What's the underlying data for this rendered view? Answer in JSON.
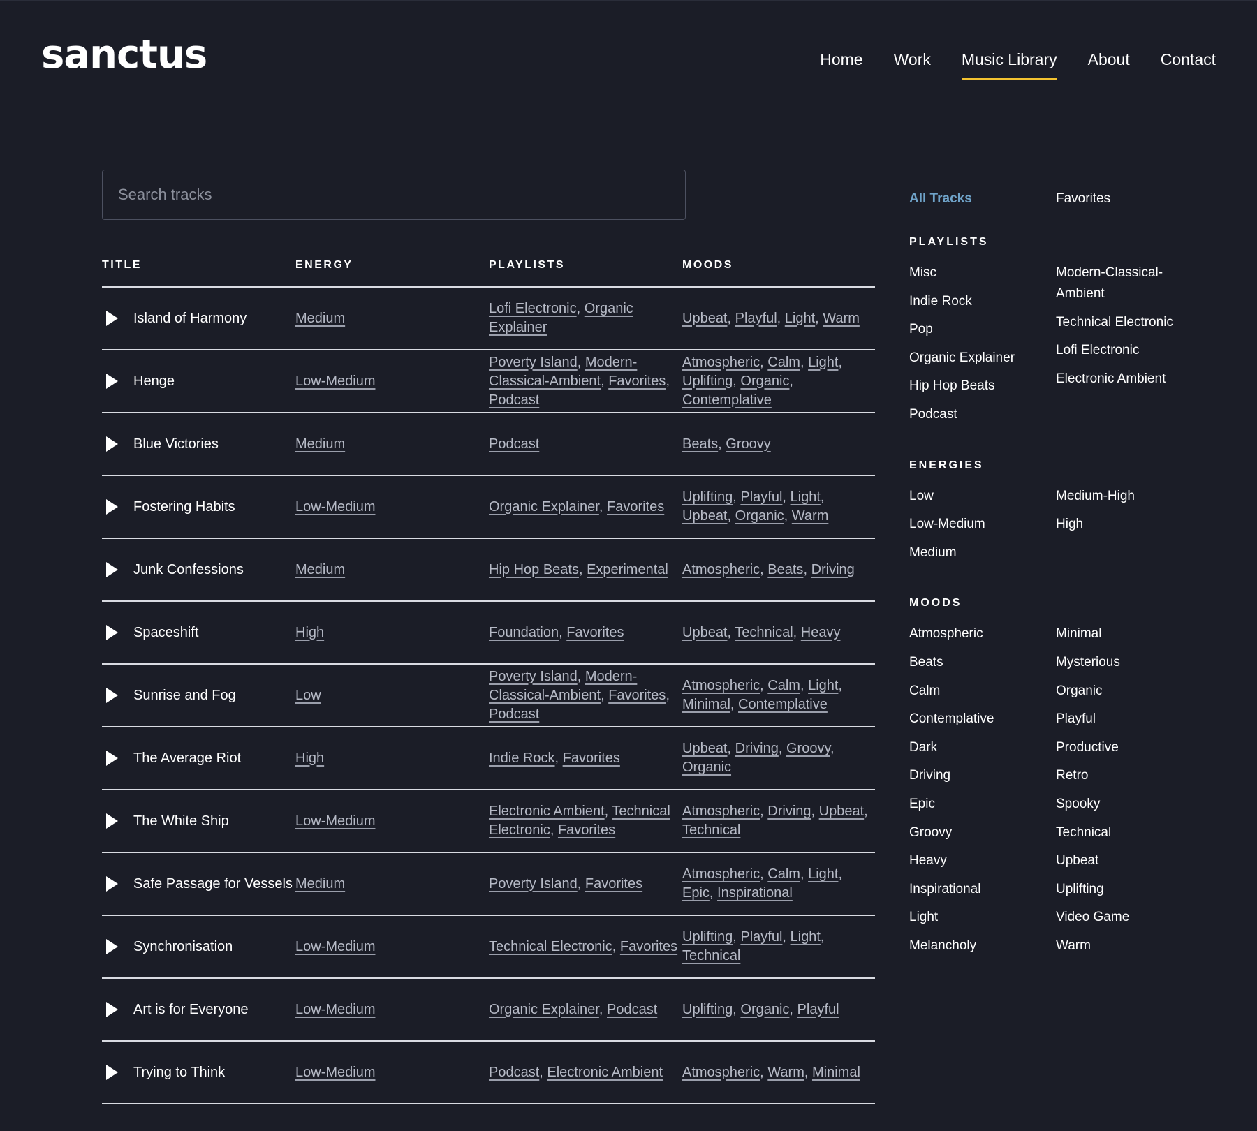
{
  "header": {
    "logo": "sanctus",
    "nav": [
      "Home",
      "Work",
      "Music Library",
      "About",
      "Contact"
    ],
    "active_nav": "Music Library",
    "accent_color": "#f2c230"
  },
  "search": {
    "placeholder": "Search tracks"
  },
  "table": {
    "columns": [
      "TITLE",
      "ENERGY",
      "PLAYLISTS",
      "MOODS"
    ],
    "rows": [
      {
        "title": "Island of Harmony",
        "energy": "Medium",
        "playlists": [
          "Lofi Electronic",
          "Organic Explainer"
        ],
        "moods": [
          "Upbeat",
          "Playful",
          "Light",
          "Warm"
        ]
      },
      {
        "title": "Henge",
        "energy": "Low-Medium",
        "playlists": [
          "Poverty Island",
          "Modern-Classical-Ambient",
          "Favorites",
          "Podcast"
        ],
        "moods": [
          "Atmospheric",
          "Calm",
          "Light",
          "Uplifting",
          "Organic",
          "Contemplative"
        ]
      },
      {
        "title": "Blue Victories",
        "energy": "Medium",
        "playlists": [
          "Podcast"
        ],
        "moods": [
          "Beats",
          "Groovy"
        ]
      },
      {
        "title": "Fostering Habits",
        "energy": "Low-Medium",
        "playlists": [
          "Organic Explainer",
          "Favorites"
        ],
        "moods": [
          "Uplifting",
          "Playful",
          "Light",
          "Upbeat",
          "Organic",
          "Warm"
        ]
      },
      {
        "title": "Junk Confessions",
        "energy": "Medium",
        "playlists": [
          "Hip Hop Beats",
          "Experimental"
        ],
        "moods": [
          "Atmospheric",
          "Beats",
          "Driving"
        ]
      },
      {
        "title": "Spaceshift",
        "energy": "High",
        "playlists": [
          "Foundation",
          "Favorites"
        ],
        "moods": [
          "Upbeat",
          "Technical",
          "Heavy"
        ]
      },
      {
        "title": "Sunrise and Fog",
        "energy": "Low",
        "playlists": [
          "Poverty Island",
          "Modern-Classical-Ambient",
          "Favorites",
          "Podcast"
        ],
        "moods": [
          "Atmospheric",
          "Calm",
          "Light",
          "Minimal",
          "Contemplative"
        ]
      },
      {
        "title": "The Average Riot",
        "energy": "High",
        "playlists": [
          "Indie Rock",
          "Favorites"
        ],
        "moods": [
          "Upbeat",
          "Driving",
          "Groovy",
          "Organic"
        ]
      },
      {
        "title": "The White Ship",
        "energy": "Low-Medium",
        "playlists": [
          "Electronic Ambient",
          "Technical Electronic",
          "Favorites"
        ],
        "moods": [
          "Atmospheric",
          "Driving",
          "Upbeat",
          "Technical"
        ]
      },
      {
        "title": "Safe Passage for Vessels",
        "energy": "Medium",
        "playlists": [
          "Poverty Island",
          "Favorites"
        ],
        "moods": [
          "Atmospheric",
          "Calm",
          "Light",
          "Epic",
          "Inspirational"
        ]
      },
      {
        "title": "Synchronisation",
        "energy": "Low-Medium",
        "playlists": [
          "Technical Electronic",
          "Favorites"
        ],
        "moods": [
          "Uplifting",
          "Playful",
          "Light",
          "Technical"
        ]
      },
      {
        "title": "Art is for Everyone",
        "energy": "Low-Medium",
        "playlists": [
          "Organic Explainer",
          "Podcast"
        ],
        "moods": [
          "Uplifting",
          "Organic",
          "Playful"
        ]
      },
      {
        "title": "Trying to Think",
        "energy": "Low-Medium",
        "playlists": [
          "Podcast",
          "Electronic Ambient"
        ],
        "moods": [
          "Atmospheric",
          "Warm",
          "Minimal"
        ]
      }
    ]
  },
  "sidebar": {
    "tabs": [
      "All Tracks",
      "Favorites"
    ],
    "active_tab": "All Tracks",
    "active_color": "#6fa3c9",
    "sections": [
      {
        "heading": "PLAYLISTS",
        "col1": [
          "Misc",
          "Indie Rock",
          "Pop",
          "Organic Explainer",
          "Hip Hop Beats",
          "Podcast"
        ],
        "col2": [
          "Modern-Classical-Ambient",
          "Technical Electronic",
          "Lofi Electronic",
          "Electronic Ambient"
        ]
      },
      {
        "heading": "ENERGIES",
        "col1": [
          "Low",
          "Low-Medium",
          "Medium"
        ],
        "col2": [
          "Medium-High",
          "High"
        ]
      },
      {
        "heading": "MOODS",
        "col1": [
          "Atmospheric",
          "Beats",
          "Calm",
          "Contemplative",
          "Dark",
          "Driving",
          "Epic",
          "Groovy",
          "Heavy",
          "Inspirational",
          "Light",
          "Melancholy"
        ],
        "col2": [
          "Minimal",
          "Mysterious",
          "Organic",
          "Playful",
          "Productive",
          "Retro",
          "Spooky",
          "Technical",
          "Upbeat",
          "Uplifting",
          "Video Game",
          "Warm"
        ]
      }
    ]
  }
}
